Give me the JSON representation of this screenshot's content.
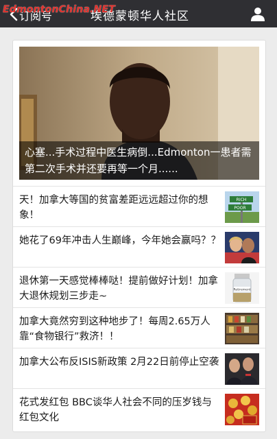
{
  "watermark": "EdmontonChina.NET",
  "nav": {
    "back_label": "订阅号",
    "title": "埃德蒙顿华人社区"
  },
  "hero": {
    "caption": "心塞...手术过程中医生病倒...Edmonton一患者需第二次手术并还要再等一个月......"
  },
  "articles": [
    {
      "title": "天！加拿大等国的贫富差距远远超过你的想象！",
      "sign_rich": "RICH",
      "sign_poor": "POOR"
    },
    {
      "title": "她花了69年冲击人生巅峰，今年她会赢吗？？"
    },
    {
      "title": "退休第一天感觉棒棒哒！提前做好计划！加拿大退休规划三步走~",
      "jar_label": "Retirement"
    },
    {
      "title": "加拿大竟然穷到这种地步了！每周2.65万人靠“食物银行”救济！！"
    },
    {
      "title": "加拿大公布反ISIS新政策 2月22日前停止空袭"
    },
    {
      "title": "花式发红包 BBC谈华人社会不同的压岁钱与红包文化"
    }
  ]
}
